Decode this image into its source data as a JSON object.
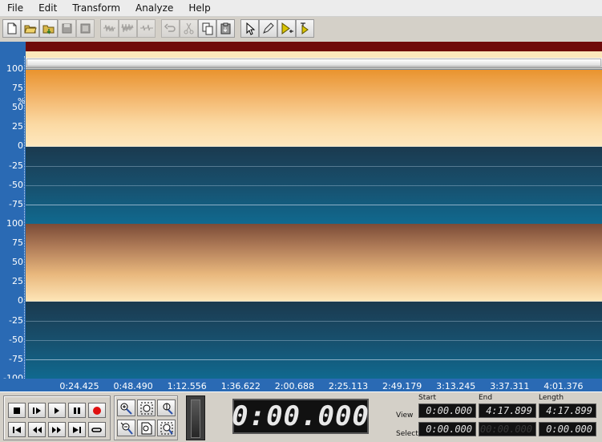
{
  "menu": [
    "File",
    "Edit",
    "Transform",
    "Analyze",
    "Help"
  ],
  "toolbar": {
    "groups": [
      [
        {
          "icon": "new-file-icon",
          "disabled": false
        },
        {
          "icon": "open-folder-icon",
          "disabled": false
        },
        {
          "icon": "open-append-icon",
          "disabled": false
        },
        {
          "icon": "save-icon",
          "disabled": true
        },
        {
          "icon": "save-all-icon",
          "disabled": true
        }
      ],
      [
        {
          "icon": "waveform-trim-icon",
          "disabled": true
        },
        {
          "icon": "waveform-mix-icon",
          "disabled": true
        },
        {
          "icon": "waveform-silence-icon",
          "disabled": true
        }
      ],
      [
        {
          "icon": "undo-icon",
          "disabled": true
        },
        {
          "icon": "cut-icon",
          "disabled": true
        },
        {
          "icon": "copy-icon",
          "disabled": false
        },
        {
          "icon": "paste-icon",
          "disabled": false
        }
      ],
      [
        {
          "icon": "select-cursor-icon",
          "disabled": false
        },
        {
          "icon": "pencil-icon",
          "disabled": false
        },
        {
          "icon": "play-marker-icon",
          "disabled": false
        },
        {
          "icon": "play-to-end-icon",
          "disabled": false
        }
      ]
    ]
  },
  "ruler": {
    "unit": "%",
    "channels": [
      [
        "100",
        "75",
        "50",
        "25",
        "0",
        "-25",
        "-50",
        "-75"
      ],
      [
        "100",
        "75",
        "50",
        "25",
        "0",
        "-25",
        "-50",
        "-75",
        "-100"
      ]
    ]
  },
  "timeline": {
    "ticks": [
      "0:24.425",
      "0:48.490",
      "1:12.556",
      "1:36.622",
      "2:00.688",
      "2:25.113",
      "2:49.179",
      "3:13.245",
      "3:37.311",
      "4:01.376"
    ]
  },
  "transport": {
    "buttons_row1": [
      "stop-icon",
      "play-selection-icon",
      "play-icon",
      "pause-icon",
      "record-icon"
    ],
    "buttons_row2": [
      "go-start-icon",
      "rewind-icon",
      "fast-forward-icon",
      "go-end-icon",
      "loop-icon"
    ],
    "zoom_row1": [
      "zoom-in-icon",
      "zoom-selection-icon",
      "zoom-vertical-in-icon"
    ],
    "zoom_row2": [
      "zoom-out-icon",
      "zoom-full-icon",
      "zoom-vertical-out-icon"
    ]
  },
  "time_display": "0:00.000",
  "selection": {
    "headers": {
      "start": "Start",
      "end": "End",
      "length": "Length"
    },
    "view": {
      "label": "View",
      "start": "0:00.000",
      "end": "4:17.899",
      "length": "4:17.899"
    },
    "select": {
      "label": "Select",
      "start": "0:00.000",
      "end": "00:00.000",
      "length": "0:00.000"
    }
  }
}
